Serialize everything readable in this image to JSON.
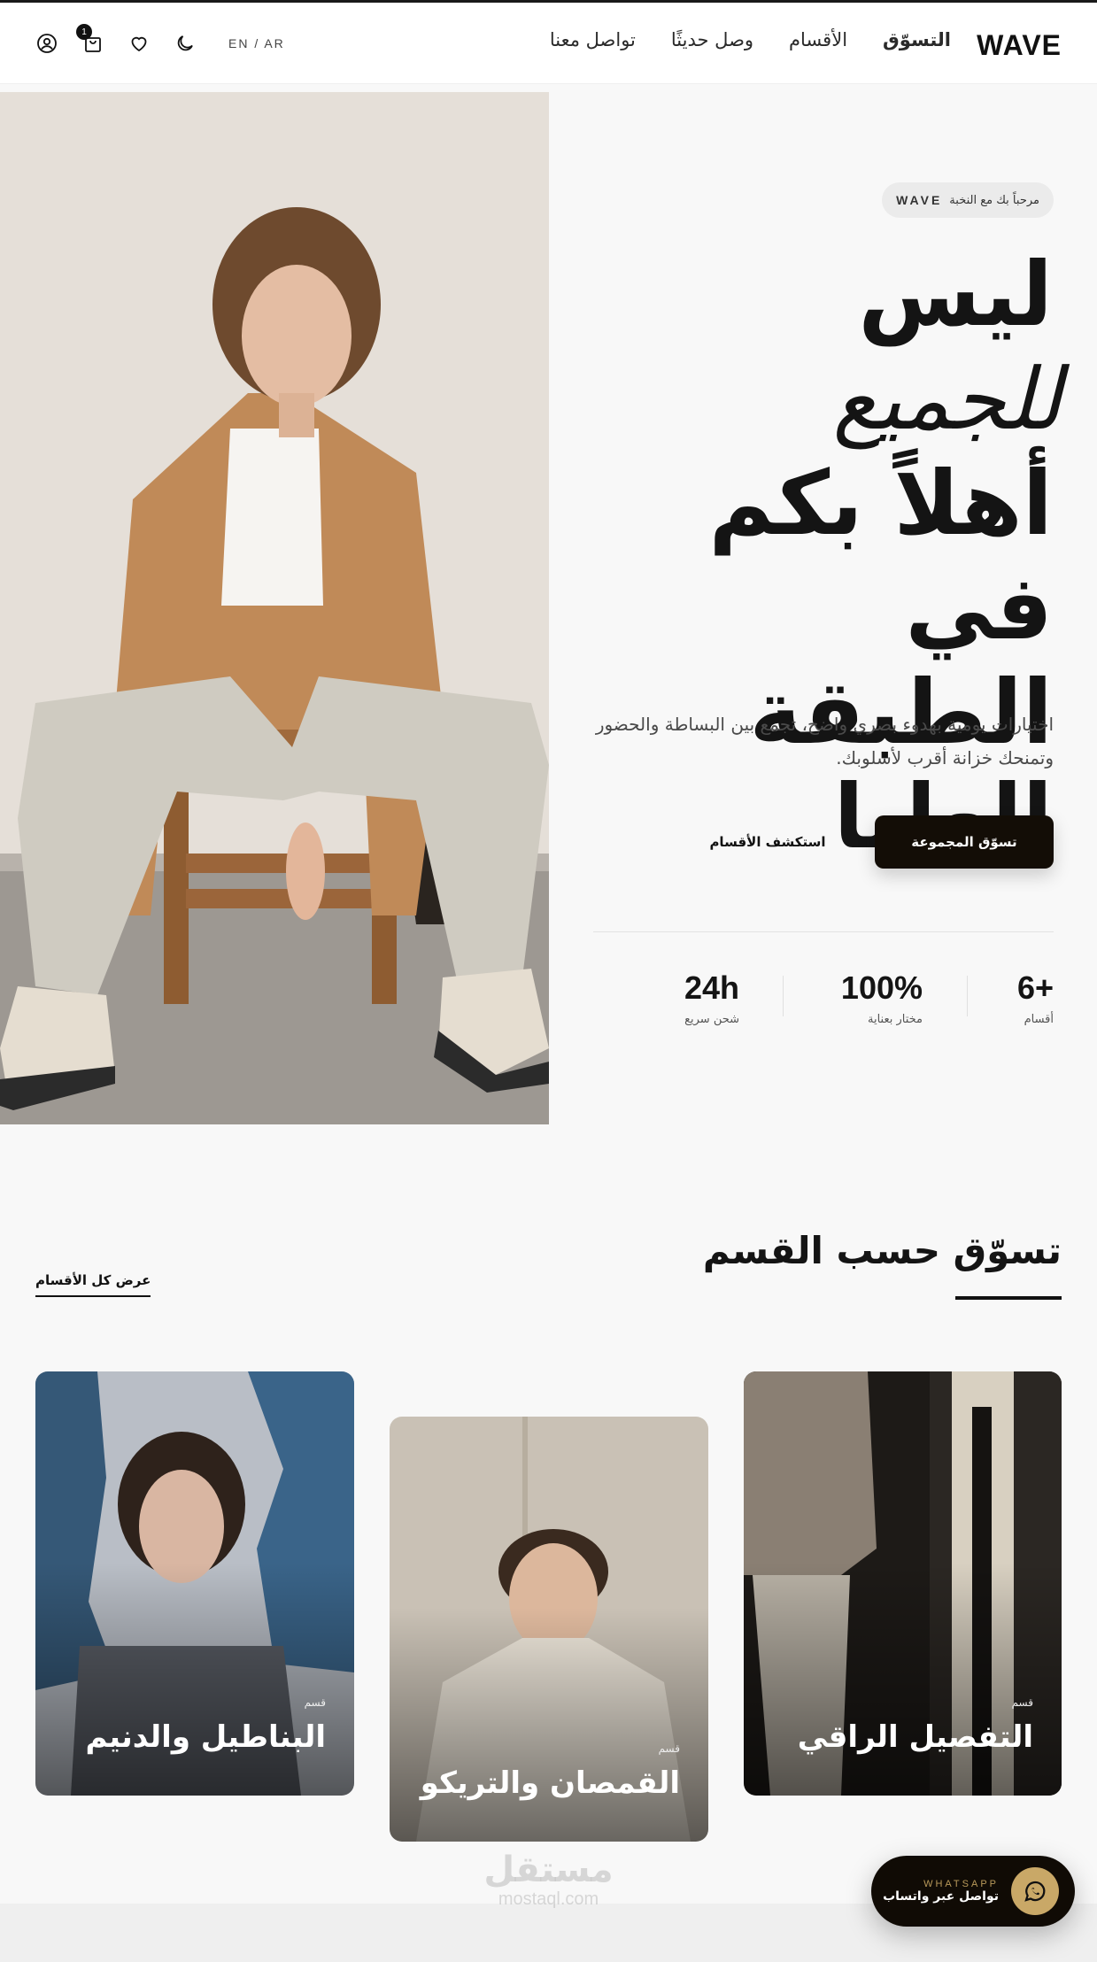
{
  "header": {
    "logo": "WAVE",
    "nav": [
      "التسوّق",
      "الأقسام",
      "وصل حديثًا",
      "تواصل معنا"
    ],
    "lang": "EN / AR",
    "cart_count": "1"
  },
  "hero": {
    "welcome": "مرحباً بك مع النخبة",
    "welcome_brand": "WAVE",
    "line1": "ليس",
    "line2": "للجميع",
    "line3": "أهلاً بكم في",
    "line4": "الطبقة العليا",
    "description": "اختيارات يومية بهدوء بصري واضح، تجمع بين البساطة والحضور وتمنحك خزانة أقرب لأسلوبك.",
    "primary_button": "تسوّق المجموعة",
    "secondary_button": "استكشف الأقسام",
    "stats": [
      {
        "value": "6+",
        "label": "أقسام"
      },
      {
        "value": "100%",
        "label": "مختار بعناية"
      },
      {
        "value": "24h",
        "label": "شحن سريع"
      }
    ]
  },
  "categories": {
    "title": "تسوّق حسب القسم",
    "view_all": "عرض كل الأقسام",
    "cards": [
      {
        "tag": "قسم",
        "title": "التفصيل الراقي"
      },
      {
        "tag": "قسم",
        "title": "القمصان والتريكو"
      },
      {
        "tag": "قسم",
        "title": "البناطيل والدنيم"
      }
    ]
  },
  "watermark": {
    "ar": "مستقل",
    "en": "mostaql.com"
  },
  "whatsapp": {
    "kicker": "WHATSAPP",
    "label": "تواصل عبر واتساب"
  }
}
